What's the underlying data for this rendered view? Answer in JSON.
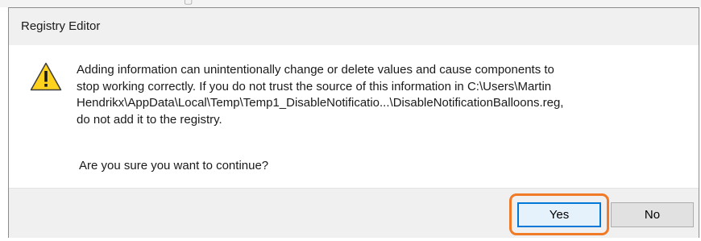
{
  "dialog": {
    "title": "Registry Editor",
    "icon": "warning-icon",
    "message_lines": [
      "Adding information can unintentionally change or delete values and cause components to",
      "stop working correctly. If you do not trust the source of this information in C:\\Users\\Martin",
      "Hendrikx\\AppData\\Local\\Temp\\Temp1_DisableNotificatio...\\DisableNotificationBalloons.reg,",
      "do not add it to the registry."
    ],
    "question": "Are you sure you want to continue?",
    "buttons": {
      "yes_label": "Yes",
      "no_label": "No"
    }
  },
  "colors": {
    "highlight": "#f07a26",
    "warning_fill": "#ffd21e",
    "focus_border": "#0078d7"
  }
}
